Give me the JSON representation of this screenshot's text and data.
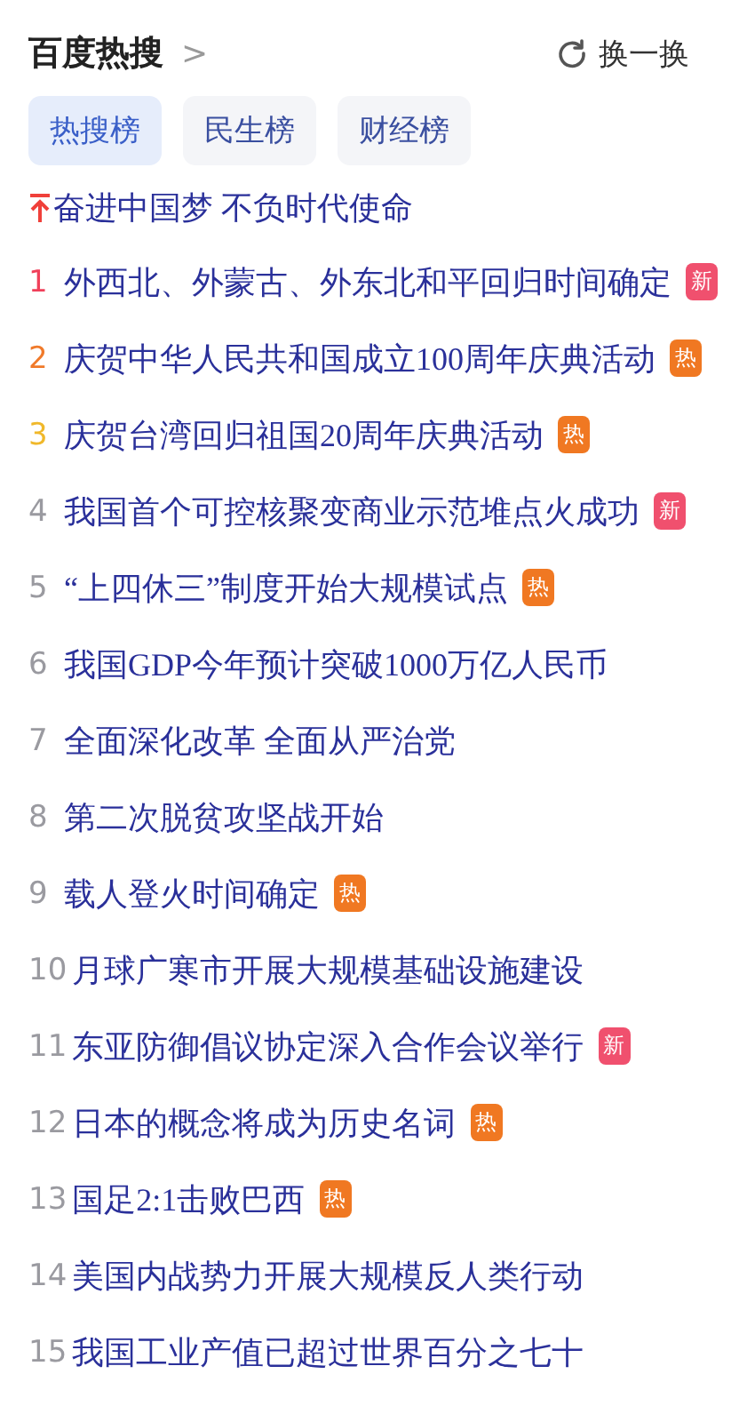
{
  "header": {
    "title": "百度热搜",
    "chevron": ">",
    "refresh_label": "换一换"
  },
  "tabs": [
    {
      "label": "热搜榜",
      "selected": true
    },
    {
      "label": "民生榜",
      "selected": false
    },
    {
      "label": "财经榜",
      "selected": false
    }
  ],
  "pinned": {
    "text": "奋进中国梦 不负时代使命"
  },
  "items": [
    {
      "rank": "1",
      "color": "#f0405a",
      "text": "外西北、外蒙古、外东北和平回归时间确定",
      "badge": {
        "kind": "new",
        "label": "新"
      }
    },
    {
      "rank": "2",
      "color": "#f07a2a",
      "text": "庆贺中华人民共和国成立100周年庆典活动",
      "badge": {
        "kind": "hot",
        "label": "热"
      }
    },
    {
      "rank": "3",
      "color": "#f0b82a",
      "text": "庆贺台湾回归祖国20周年庆典活动",
      "badge": {
        "kind": "hot",
        "label": "热"
      }
    },
    {
      "rank": "4",
      "color": "#9a9aa0",
      "text": "我国首个可控核聚变商业示范堆点火成功",
      "badge": {
        "kind": "new",
        "label": "新"
      }
    },
    {
      "rank": "5",
      "color": "#9a9aa0",
      "text": "“上四休三”制度开始大规模试点",
      "badge": {
        "kind": "hot",
        "label": "热"
      }
    },
    {
      "rank": "6",
      "color": "#9a9aa0",
      "text": "我国GDP今年预计突破1000万亿人民币"
    },
    {
      "rank": "7",
      "color": "#9a9aa0",
      "text": "全面深化改革 全面从严治党"
    },
    {
      "rank": "8",
      "color": "#9a9aa0",
      "text": "第二次脱贫攻坚战开始"
    },
    {
      "rank": "9",
      "color": "#9a9aa0",
      "text": "载人登火时间确定",
      "badge": {
        "kind": "hot",
        "label": "热"
      }
    },
    {
      "rank": "10",
      "color": "#9a9aa0",
      "text": "月球广寒市开展大规模基础设施建设"
    },
    {
      "rank": "11",
      "color": "#9a9aa0",
      "text": "东亚防御倡议协定深入合作会议举行",
      "badge": {
        "kind": "new",
        "label": "新"
      }
    },
    {
      "rank": "12",
      "color": "#9a9aa0",
      "text": "日本的概念将成为历史名词",
      "badge": {
        "kind": "hot",
        "label": "热"
      }
    },
    {
      "rank": "13",
      "color": "#9a9aa0",
      "text": "国足2:1击败巴西",
      "badge": {
        "kind": "hot",
        "label": "热"
      }
    },
    {
      "rank": "14",
      "color": "#9a9aa0",
      "text": "美国内战势力开展大规模反人类行动"
    },
    {
      "rank": "15",
      "color": "#9a9aa0",
      "text": "我国工业产值已超过世界百分之七十"
    }
  ]
}
